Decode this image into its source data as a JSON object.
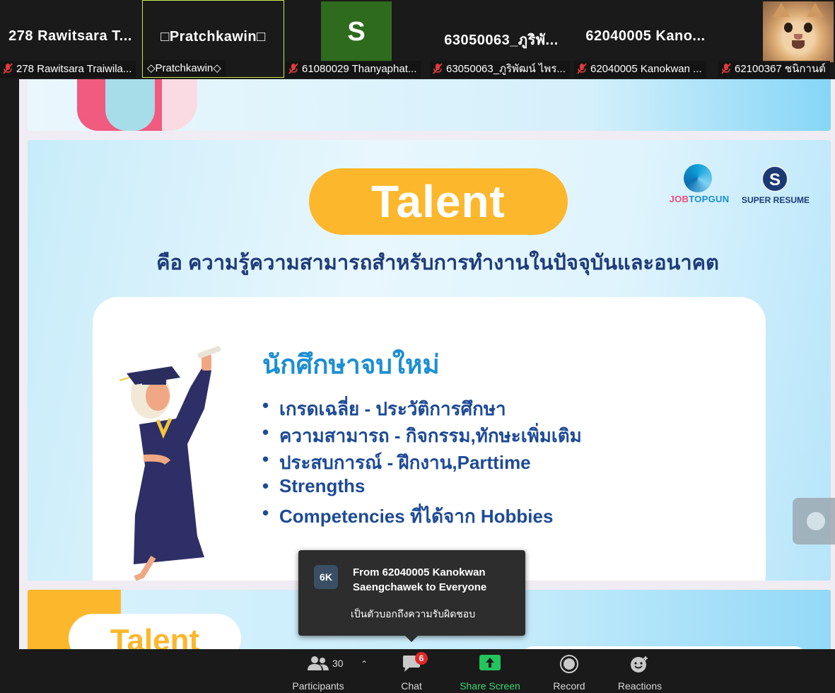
{
  "gallery": {
    "tiles": [
      {
        "big_name": "278 Rawitsara T...",
        "caption": "278 Rawitsara Traiwila..."
      },
      {
        "big_name": "□Pratchkawin□",
        "caption": "◇Pratchkawin◇"
      },
      {
        "avatar_letter": "S",
        "caption": "61080029 Thanyaphat..."
      },
      {
        "big_name": "63050063_ภูริพั...",
        "caption": "63050063_ภูริพัฒน์ ไพร..."
      },
      {
        "big_name": "62040005 Kano...",
        "caption": "62040005 Kanokwan ..."
      },
      {
        "caption": "62100367 ชนิกานต์"
      }
    ]
  },
  "slide": {
    "title": "Talent",
    "subtitle": "คือ ความรู้ความสามารถสำหรับการทำงานในปัจจุบันและอนาคต",
    "logo_left_a": "JOB",
    "logo_left_b": "TOPGUN",
    "logo_right": "SUPER RESUME",
    "logo_right_letter": "S",
    "card_title": "นักศึกษาจบใหม่",
    "bullets": [
      "เกรดเฉลี่ย - ประวัติการศึกษา",
      "ความสามารถ - กิจกรรม,ทักษะเพิ่มเติม",
      "ประสบการณ์ - ฝึกงาน,Parttime",
      "Strengths",
      "Competencies ที่ได้จาก Hobbies"
    ],
    "next_title": "Talent"
  },
  "toast": {
    "avatar": "6K",
    "from": "From 62040005 Kanokwan Saengchawek to Everyone",
    "message": "เป็นตัวบอกถึงความรับผิดชอบ"
  },
  "toolbar": {
    "participants_label": "Participants",
    "participants_count": "30",
    "chat_label": "Chat",
    "chat_badge": "6",
    "share_label": "Share Screen",
    "record_label": "Record",
    "reactions_label": "Reactions"
  },
  "colors": {
    "talent_yellow": "#fcb72c",
    "share_green": "#3bd671",
    "badge_red": "#e02828",
    "active_speaker": "#c8e84a"
  },
  "icons": [
    "muted-mic-icon",
    "participants-icon",
    "caret-up-icon",
    "chat-icon",
    "share-screen-icon",
    "record-icon",
    "reactions-icon"
  ]
}
